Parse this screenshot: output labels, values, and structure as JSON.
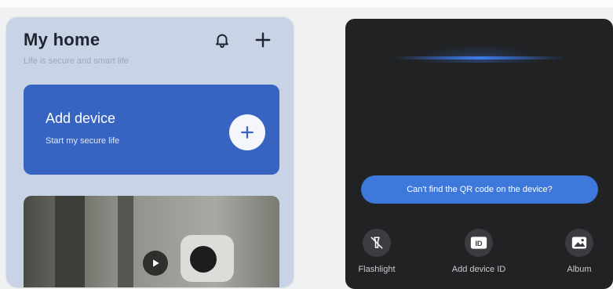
{
  "home": {
    "title": "My home",
    "subtitle": "Life is secure and smart life",
    "add_card": {
      "title": "Add device",
      "subtitle": "Start my secure life"
    }
  },
  "scan": {
    "qr_help": "Can't find the QR code on the device?",
    "tools": [
      {
        "label": "Flashlight",
        "icon": "flashlight-icon"
      },
      {
        "label": "Add device ID",
        "icon": "id-icon"
      },
      {
        "label": "Album",
        "icon": "image-icon"
      }
    ]
  },
  "colors": {
    "accent": "#3764c0",
    "scan_button": "#3d78da",
    "dark_bg": "#202224"
  }
}
